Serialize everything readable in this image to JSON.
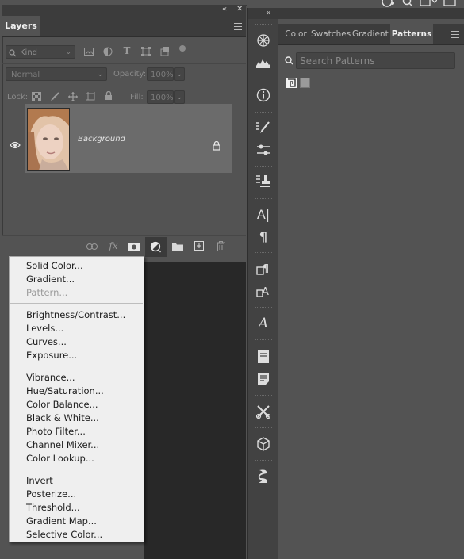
{
  "layers_panel": {
    "tab_label": "Layers",
    "filter": {
      "kind_label": "Kind"
    },
    "blend_mode": "Normal",
    "opacity_label": "Opacity:",
    "opacity_value": "100%",
    "lock_label": "Lock:",
    "fill_label": "Fill:",
    "fill_value": "100%",
    "layer": {
      "name": "Background"
    },
    "footer_fx": "fx"
  },
  "adjustment_menu": {
    "items": [
      "Solid Color...",
      "Gradient...",
      "Pattern...",
      "Brightness/Contrast...",
      "Levels...",
      "Curves...",
      "Exposure...",
      "Vibrance...",
      "Hue/Saturation...",
      "Color Balance...",
      "Black & White...",
      "Photo Filter...",
      "Channel Mixer...",
      "Color Lookup...",
      "Invert",
      "Posterize...",
      "Threshold...",
      "Gradient Map...",
      "Selective Color..."
    ]
  },
  "right_panel": {
    "tabs": [
      "Color",
      "Swatches",
      "Gradients",
      "Patterns"
    ],
    "active_tab": "Patterns",
    "search_placeholder": "Search Patterns"
  },
  "icons": {
    "collapse": "double-chevron",
    "close": "close-x",
    "tool_strip": [
      "color-wheel-icon",
      "histogram-icon",
      "info-icon",
      "brush-settings-icon",
      "sliders-icon",
      "clone-source-icon",
      "character-icon",
      "paragraph-icon",
      "character-styles-icon",
      "paragraph-styles-icon",
      "glyphs-icon",
      "notes-icon",
      "properties-icon",
      "tools-icon",
      "3d-icon",
      "timeline-icon"
    ]
  }
}
